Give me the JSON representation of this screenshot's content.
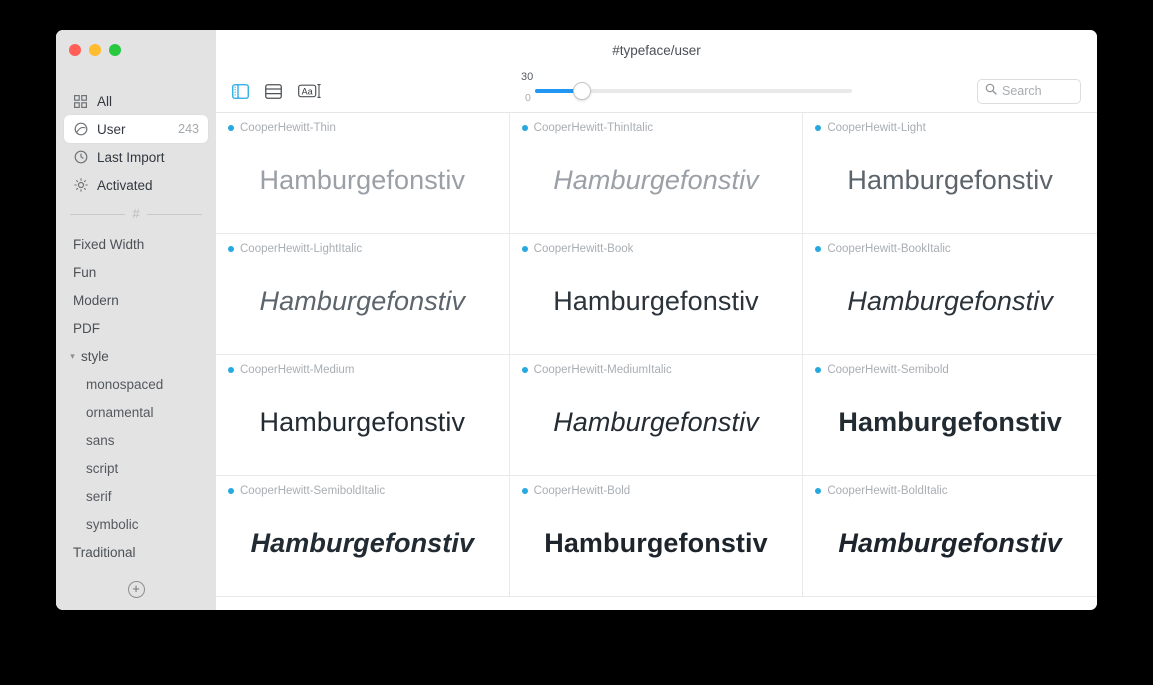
{
  "window": {
    "title": "#typeface/user",
    "traffic_lights": [
      "close",
      "minimize",
      "zoom"
    ]
  },
  "sidebar": {
    "nav": [
      {
        "label": "All",
        "icon": "grid-icon",
        "count": "",
        "selected": false
      },
      {
        "label": "User",
        "icon": "user-icon",
        "count": "243",
        "selected": true
      },
      {
        "label": "Last Import",
        "icon": "clock-icon",
        "count": "",
        "selected": false
      },
      {
        "label": "Activated",
        "icon": "sun-icon",
        "count": "",
        "selected": false
      }
    ],
    "divider_glyph": "#",
    "tags": [
      {
        "label": "Fixed Width",
        "level": "top"
      },
      {
        "label": "Fun",
        "level": "top"
      },
      {
        "label": "Modern",
        "level": "top"
      },
      {
        "label": "PDF",
        "level": "top"
      },
      {
        "label": "style",
        "level": "group",
        "expanded": true
      },
      {
        "label": "monospaced",
        "level": "child"
      },
      {
        "label": "ornamental",
        "level": "child"
      },
      {
        "label": "sans",
        "level": "child"
      },
      {
        "label": "script",
        "level": "child"
      },
      {
        "label": "serif",
        "level": "child"
      },
      {
        "label": "symbolic",
        "level": "child"
      },
      {
        "label": "Traditional",
        "level": "top"
      }
    ],
    "add_label": "+"
  },
  "toolbar": {
    "sidebar_toggle_icon": "sidebar-toggle-icon",
    "list_view_icon": "list-view-icon",
    "text_sample_icon": "text-sample-icon",
    "accent_color": "#2196f3",
    "slider": {
      "value": "30",
      "min_label": "0"
    },
    "search": {
      "placeholder": "Search",
      "value": ""
    }
  },
  "grid": {
    "sample_text": "Hamburgefonstiv",
    "cards": [
      {
        "name": "CooperHewitt-Thin",
        "style": "w-thin"
      },
      {
        "name": "CooperHewitt-ThinItalic",
        "style": "w-thin it"
      },
      {
        "name": "CooperHewitt-Light",
        "style": "w-light"
      },
      {
        "name": "CooperHewitt-LightItalic",
        "style": "w-light it"
      },
      {
        "name": "CooperHewitt-Book",
        "style": "w-book"
      },
      {
        "name": "CooperHewitt-BookItalic",
        "style": "w-book it"
      },
      {
        "name": "CooperHewitt-Medium",
        "style": "w-medium"
      },
      {
        "name": "CooperHewitt-MediumItalic",
        "style": "w-medium it"
      },
      {
        "name": "CooperHewitt-Semibold",
        "style": "w-semibold"
      },
      {
        "name": "CooperHewitt-SemiboldItalic",
        "style": "w-semibold it"
      },
      {
        "name": "CooperHewitt-Bold",
        "style": "w-bold"
      },
      {
        "name": "CooperHewitt-BoldItalic",
        "style": "w-bold it"
      }
    ]
  }
}
